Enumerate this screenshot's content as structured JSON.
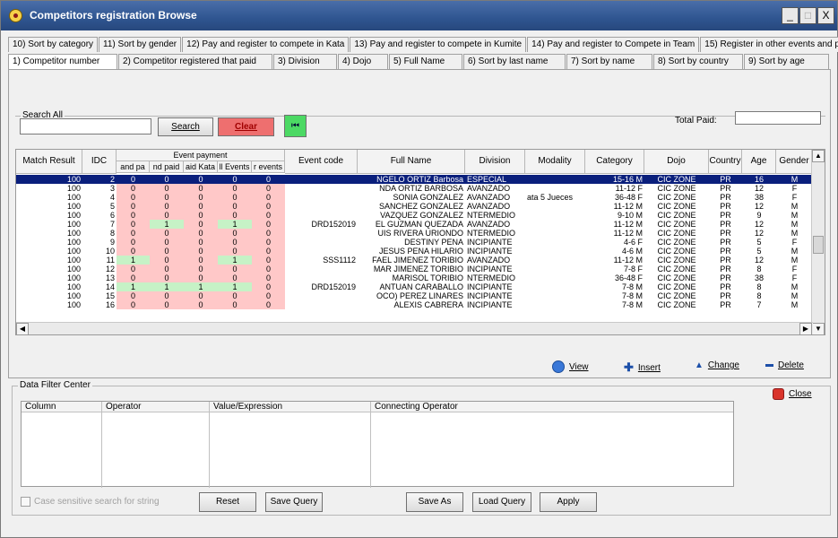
{
  "window": {
    "title": "Competitors registration Browse",
    "buttons": [
      "_",
      "□",
      "X"
    ]
  },
  "tabs_row1": [
    "10) Sort by category",
    "11) Sort by gender",
    "12) Pay and register to compete in Kata",
    "13) Pay and register to compete in Kumite",
    "14) Pay and register to Compete in Team",
    "15) Register in other events and paid"
  ],
  "tabs_row2": [
    "1) Competitor number",
    "2) Competitor registered that paid",
    "3) Division",
    "4) Dojo",
    "5) Full Name",
    "6) Sort by last name",
    "7) Sort by name",
    "8) Sort by country",
    "9) Sort by age"
  ],
  "search": {
    "group_label": "Search All",
    "value": "",
    "search_label": "Search",
    "clear_label": "Clear",
    "first_label": "⏮",
    "total_paid_label": "Total Paid:",
    "total_paid_value": ""
  },
  "grid": {
    "headers": [
      "Match Result",
      "IDC",
      "Event payment",
      "Event code",
      "Full Name",
      "Division",
      "Modality",
      "Category",
      "Dojo",
      "Country",
      "Age",
      "Gender"
    ],
    "subheaders": [
      "and pa",
      "nd paid",
      "aid Kata",
      "ll Events",
      "r events"
    ],
    "rows": [
      [
        "100",
        "2",
        "0",
        "0",
        "0",
        "0",
        "0",
        "",
        "NGELO ORTIZ Barbosa",
        "ESPECIAL",
        "",
        "15-16 M",
        "CIC ZONE",
        "PR",
        "16",
        "M"
      ],
      [
        "100",
        "3",
        "0",
        "0",
        "0",
        "0",
        "0",
        "",
        "NDA ORTIZ BARBOSA",
        "AVANZADO",
        "",
        "11-12 F",
        "CIC ZONE",
        "PR",
        "12",
        "F"
      ],
      [
        "100",
        "4",
        "0",
        "0",
        "0",
        "0",
        "0",
        "",
        "SONIA GONZALEZ",
        "AVANZADO",
        "ata 5 Jueces",
        "36-48 F",
        "CIC ZONE",
        "PR",
        "38",
        "F"
      ],
      [
        "100",
        "5",
        "0",
        "0",
        "0",
        "0",
        "0",
        "",
        "SANCHEZ GONZALEZ",
        "AVANZADO",
        "",
        "11-12 M",
        "CIC ZONE",
        "PR",
        "12",
        "M"
      ],
      [
        "100",
        "6",
        "0",
        "0",
        "0",
        "0",
        "0",
        "",
        "VAZQUEZ GONZALEZ",
        "NTERMEDIO",
        "",
        "9-10 M",
        "CIC ZONE",
        "PR",
        "9",
        "M"
      ],
      [
        "100",
        "7",
        "0",
        "1",
        "0",
        "1",
        "0",
        "DRD152019",
        "EL GUZMAN QUEZADA",
        "AVANZADO",
        "",
        "11-12 M",
        "CIC ZONE",
        "PR",
        "12",
        "M"
      ],
      [
        "100",
        "8",
        "0",
        "0",
        "0",
        "0",
        "0",
        "",
        "UIS RIVERA URIONDO",
        "NTERMEDIO",
        "",
        "11-12 M",
        "CIC ZONE",
        "PR",
        "12",
        "M"
      ],
      [
        "100",
        "9",
        "0",
        "0",
        "0",
        "0",
        "0",
        "",
        "DESTINY PENA",
        "INCIPIANTE",
        "",
        "4-6 F",
        "CIC ZONE",
        "PR",
        "5",
        "F"
      ],
      [
        "100",
        "10",
        "0",
        "0",
        "0",
        "0",
        "0",
        "",
        "JESUS PENA HILARIO",
        "INCIPIANTE",
        "",
        "4-6 M",
        "CIC ZONE",
        "PR",
        "5",
        "M"
      ],
      [
        "100",
        "11",
        "1",
        "0",
        "0",
        "1",
        "0",
        "SSS1112",
        "FAEL JIMENEZ TORIBIO",
        "AVANZADO",
        "",
        "11-12 M",
        "CIC ZONE",
        "PR",
        "12",
        "M"
      ],
      [
        "100",
        "12",
        "0",
        "0",
        "0",
        "0",
        "0",
        "",
        "MAR JIMENEZ TORIBIO",
        "INCIPIANTE",
        "",
        "7-8 F",
        "CIC ZONE",
        "PR",
        "8",
        "F"
      ],
      [
        "100",
        "13",
        "0",
        "0",
        "0",
        "0",
        "0",
        "",
        "MARISOL TORIBIO",
        "NTERMEDIO",
        "",
        "36-48 F",
        "CIC ZONE",
        "PR",
        "38",
        "F"
      ],
      [
        "100",
        "14",
        "1",
        "1",
        "1",
        "1",
        "0",
        "DRD152019",
        "ANTUAN CARABALLO",
        "INCIPIANTE",
        "",
        "7-8 M",
        "CIC ZONE",
        "PR",
        "8",
        "M"
      ],
      [
        "100",
        "15",
        "0",
        "0",
        "0",
        "0",
        "0",
        "",
        "OCO) PEREZ LINARES",
        "INCIPIANTE",
        "",
        "7-8 M",
        "CIC ZONE",
        "PR",
        "8",
        "M"
      ],
      [
        "100",
        "16",
        "0",
        "0",
        "0",
        "0",
        "0",
        "",
        "ALEXIS CABRERA",
        "INCIPIANTE",
        "",
        "7-8 M",
        "CIC ZONE",
        "PR",
        "7",
        "M"
      ]
    ]
  },
  "actions": {
    "view": "View",
    "insert": "Insert",
    "change": "Change",
    "delete": "Delete",
    "close": "Close"
  },
  "filter": {
    "group_label": "Data Filter Center",
    "columns": [
      "Column",
      "Operator",
      "Value/Expression",
      "Connecting Operator"
    ],
    "case_label": "Case sensitive search for string",
    "reset": "Reset",
    "save_query": "Save Query",
    "save_as": "Save As",
    "load_query": "Load Query",
    "apply": "Apply"
  }
}
